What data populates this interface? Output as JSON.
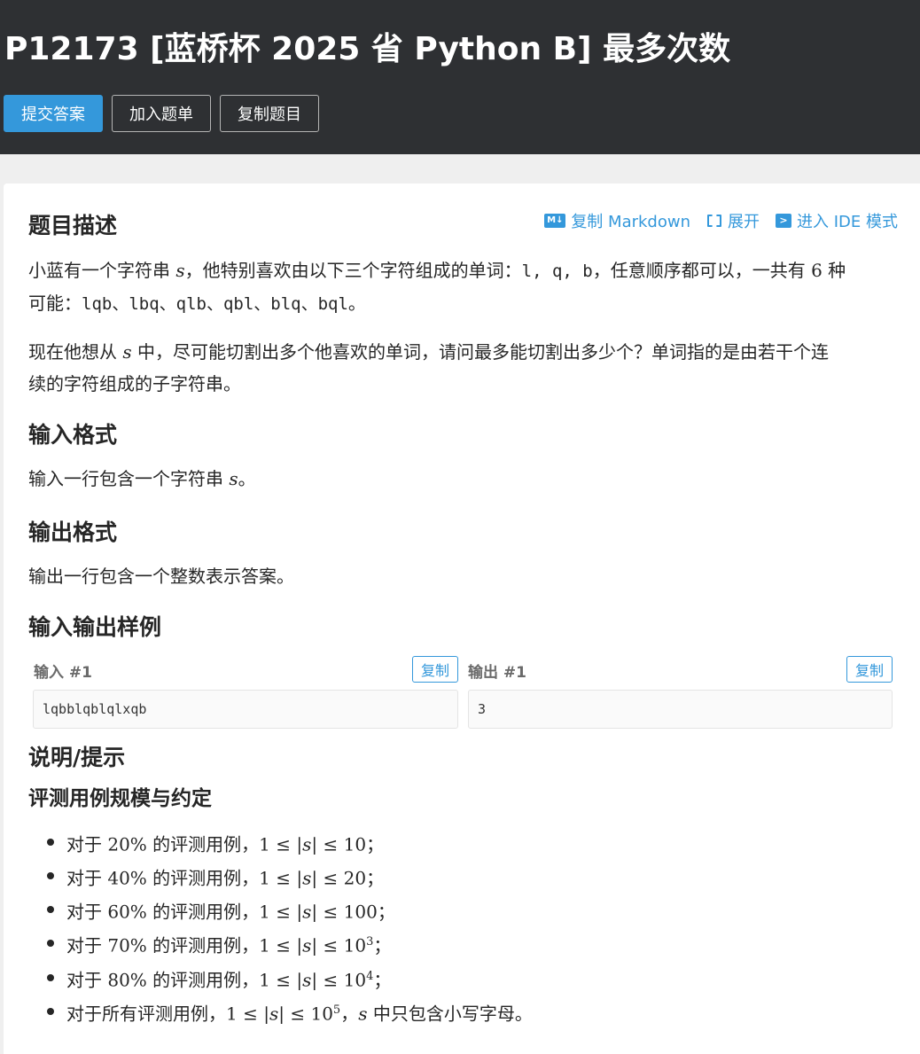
{
  "header": {
    "title": "P12173 [蓝桥杯 2025 省 Python B] 最多次数",
    "buttons": {
      "submit": "提交答案",
      "add_list": "加入题单",
      "copy_problem": "复制题目"
    }
  },
  "toolbar": {
    "copy_markdown": "复制 Markdown",
    "expand": "展开",
    "ide_mode": "进入 IDE 模式",
    "md_icon_text": "M↓"
  },
  "sections": {
    "description_title": "题目描述",
    "input_title": "输入格式",
    "output_title": "输出格式",
    "samples_title": "输入输出样例",
    "hint_title": "说明/提示",
    "scale_title": "评测用例规模与约定"
  },
  "description": {
    "p1_a": "小蓝有一个字符串 ",
    "p1_var": "s",
    "p1_b": "，他特别喜欢由以下三个字符组成的单词：",
    "p1_chars": "l, q, b",
    "p1_c": "，任意顺序都可以，一共有 ",
    "p1_num": "6",
    "p1_d": " 种",
    "p1_line2_a": "可能：",
    "p1_words": "lqb、lbq、qlb、qbl、blq、bql",
    "p1_end": "。",
    "p2_a": "现在他想从 ",
    "p2_var": "s",
    "p2_b": " 中，尽可能切割出多个他喜欢的单词，请问最多能切割出多少个？单词指的是由若干个连",
    "p2_line2": "续的字符组成的子字符串。"
  },
  "input_format": {
    "text": "输入一行包含一个字符串 ",
    "var": "s",
    "end": "。"
  },
  "output_format": {
    "text": "输出一行包含一个整数表示答案。"
  },
  "samples": {
    "input_label": "输入 #1",
    "output_label": "输出 #1",
    "copy_label": "复制",
    "input_value": "lqbblqblqlxqb",
    "output_value": "3"
  },
  "limits": [
    {
      "prefix": "对于 ",
      "pct": "20%",
      "mid": " 的评测用例，",
      "lo": "1",
      "hi": "10",
      "exp": "",
      "end": "；"
    },
    {
      "prefix": "对于 ",
      "pct": "40%",
      "mid": " 的评测用例，",
      "lo": "1",
      "hi": "20",
      "exp": "",
      "end": "；"
    },
    {
      "prefix": "对于 ",
      "pct": "60%",
      "mid": " 的评测用例，",
      "lo": "1",
      "hi": "100",
      "exp": "",
      "end": "；"
    },
    {
      "prefix": "对于 ",
      "pct": "70%",
      "mid": " 的评测用例，",
      "lo": "1",
      "hi": "10",
      "exp": "3",
      "end": "；"
    },
    {
      "prefix": "对于 ",
      "pct": "80%",
      "mid": " 的评测用例，",
      "lo": "1",
      "hi": "10",
      "exp": "4",
      "end": "；"
    }
  ],
  "limit_last": {
    "prefix": "对于所有评测用例，",
    "lo": "1",
    "hi": "10",
    "exp": "5",
    "sep": "，",
    "var": "s",
    "end": " 中只包含小写字母。"
  },
  "math": {
    "leq": "≤",
    "bar": "|",
    "var": "s"
  },
  "colors": {
    "header_bg": "#2e3033",
    "accent": "#3498db",
    "page_bg": "#efefef"
  }
}
